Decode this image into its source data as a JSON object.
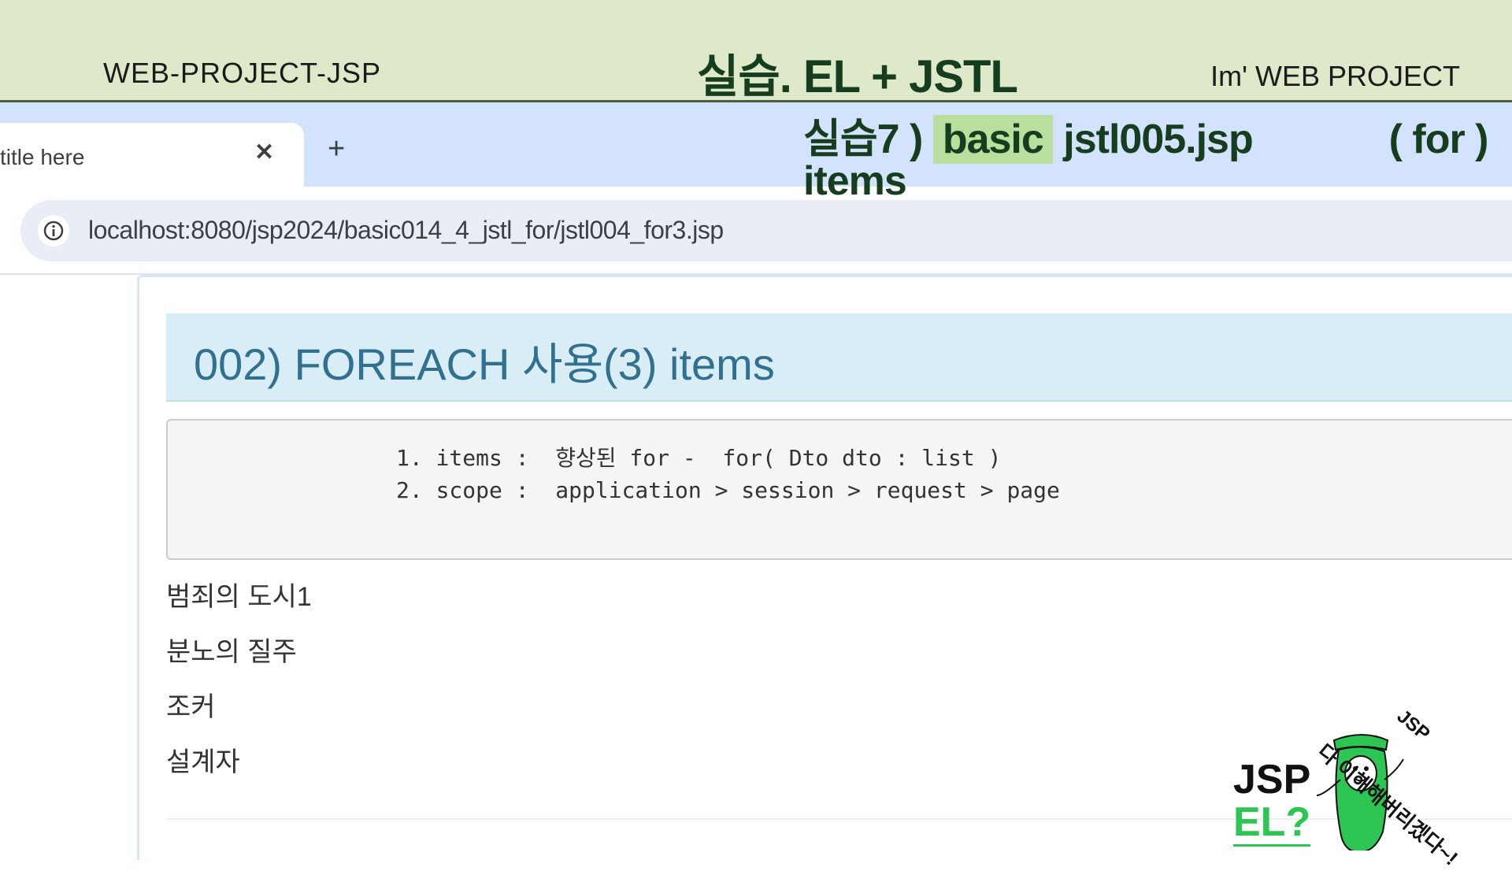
{
  "slide": {
    "project_name": "WEB-PROJECT-JSP",
    "title": "실습. EL + JSTL",
    "brand": "Im' WEB PROJECT",
    "practice_label": "실습7 )",
    "practice_highlight": "basic",
    "practice_file": "jstl005.jsp",
    "practice_note": "( for )",
    "practice_items": "items"
  },
  "browser": {
    "tab_title": "title here",
    "url": "localhost:8080/jsp2024/basic014_4_jstl_for/jstl004_for3.jsp"
  },
  "page": {
    "heading": "002) FOREACH 사용(3) items",
    "code_lines": [
      "1. items :  향상된 for -  for( Dto dto : list )",
      "2. scope :  application > session > request > page"
    ],
    "items": [
      "범죄의 도시1",
      "분노의 질주",
      "조커",
      "설계자"
    ]
  },
  "mascot": {
    "jsp": "JSP",
    "el": "EL?",
    "speech": "다 이해해버리겠다~!",
    "tag": "JSP"
  },
  "colors": {
    "header_band": "#dde9c9",
    "tab_strip": "#d3e3fd",
    "heading_bg": "#d9edf7",
    "heading_text": "#31708f",
    "highlight": "#b8df9d",
    "mascot_green": "#2dc653"
  }
}
